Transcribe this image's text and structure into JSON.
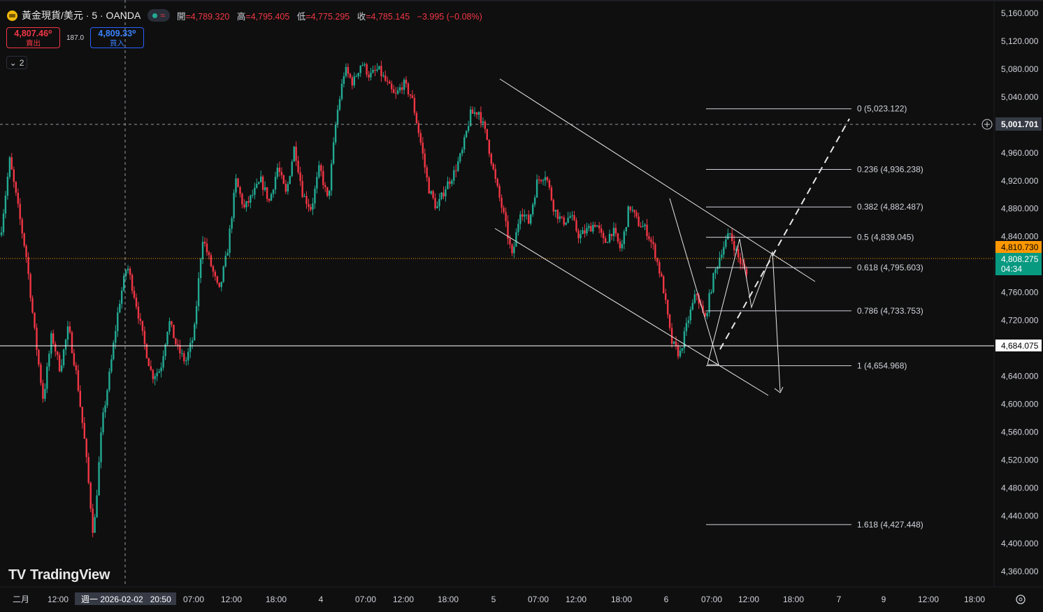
{
  "header": {
    "symbol": "黃金現貨/美元 · 5 · OANDA",
    "open_label": "開",
    "open": "=4,789.320",
    "high_label": "高",
    "high": "=4,795.405",
    "low_label": "低",
    "low": "=4,775.295",
    "close_label": "收",
    "close": "=4,785.145",
    "change": "−3.995 (−0.08%)"
  },
  "trade": {
    "sell_price": "4,807.46⁰",
    "sell_label": "賣出",
    "spread": "187.0",
    "buy_price": "4,809.33⁰",
    "buy_label": "買入",
    "collapse_count": "2"
  },
  "logo_text": "TradingView",
  "colors": {
    "up": "#22ab94",
    "down": "#f23645",
    "background": "#0f0f0f",
    "current_price": "#ff9800",
    "countdown": "#22ab94"
  },
  "price_axis": {
    "ticks": [
      "5,160.000",
      "5,120.000",
      "5,080.000",
      "5,040.000",
      "4,960.000",
      "4,920.000",
      "4,880.000",
      "4,840.000",
      "4,760.000",
      "4,720.000",
      "4,640.000",
      "4,600.000",
      "4,560.000",
      "4,520.000",
      "4,480.000",
      "4,440.000",
      "4,400.000",
      "4,360.000"
    ],
    "crosshair_price": "5,001.701",
    "current_price": "4,810.730",
    "last_price": "4,808.275",
    "countdown": "04:34",
    "hline_price": "4,684.075"
  },
  "time_axis": {
    "labels": [
      "二月",
      "12:00",
      "07:00",
      "12:00",
      "18:00",
      "4",
      "07:00",
      "12:00",
      "18:00",
      "5",
      "07:00",
      "12:00",
      "18:00",
      "6",
      "07:00",
      "12:00",
      "18:00",
      "7",
      "9",
      "12:00",
      "18:00"
    ],
    "crosshair_label": "週一 2026-02-02   20:50"
  },
  "fibonacci": [
    {
      "level": "0",
      "price": "(5,023.122)"
    },
    {
      "level": "0.236",
      "price": "(4,936.238)"
    },
    {
      "level": "0.382",
      "price": "(4,882.487)"
    },
    {
      "level": "0.5",
      "price": "(4,839.045)"
    },
    {
      "level": "0.618",
      "price": "(4,795.603)"
    },
    {
      "level": "0.786",
      "price": "(4,733.753)"
    },
    {
      "level": "1",
      "price": "(4,654.968)"
    },
    {
      "level": "1.618",
      "price": "(4,427.448)"
    }
  ],
  "chart_data": {
    "type": "candlestick",
    "title": "黃金現貨/美元 · 5 · OANDA",
    "ylim": [
      4340,
      5180
    ],
    "path": [
      [
        4853,
        4842
      ],
      [
        4950,
        4852
      ],
      [
        4880,
        4935
      ],
      [
        4810,
        4880
      ],
      [
        4700,
        4810
      ],
      [
        4606,
        4700
      ],
      [
        4700,
        4606
      ],
      [
        4650,
        4700
      ],
      [
        4710,
        4650
      ],
      [
        4640,
        4710
      ],
      [
        4540,
        4640
      ],
      [
        4410,
        4540
      ],
      [
        4570,
        4410
      ],
      [
        4650,
        4570
      ],
      [
        4740,
        4650
      ],
      [
        4800,
        4740
      ],
      [
        4750,
        4800
      ],
      [
        4690,
        4750
      ],
      [
        4640,
        4690
      ],
      [
        4650,
        4640
      ],
      [
        4720,
        4650
      ],
      [
        4680,
        4720
      ],
      [
        4660,
        4680
      ],
      [
        4700,
        4660
      ],
      [
        4840,
        4700
      ],
      [
        4800,
        4840
      ],
      [
        4760,
        4800
      ],
      [
        4820,
        4760
      ],
      [
        4920,
        4820
      ],
      [
        4880,
        4920
      ],
      [
        4900,
        4880
      ],
      [
        4920,
        4900
      ],
      [
        4890,
        4920
      ],
      [
        4940,
        4890
      ],
      [
        4900,
        4940
      ],
      [
        4970,
        4900
      ],
      [
        4900,
        4970
      ],
      [
        4880,
        4900
      ],
      [
        4940,
        4880
      ],
      [
        4890,
        4940
      ],
      [
        5010,
        4890
      ],
      [
        5080,
        5010
      ],
      [
        5060,
        5080
      ],
      [
        5090,
        5060
      ],
      [
        5070,
        5090
      ],
      [
        5080,
        5070
      ],
      [
        5060,
        5080
      ],
      [
        5040,
        5060
      ],
      [
        5060,
        5040
      ],
      [
        5040,
        5060
      ],
      [
        4980,
        5040
      ],
      [
        4910,
        4980
      ],
      [
        4880,
        4910
      ],
      [
        4910,
        4880
      ],
      [
        4930,
        4910
      ],
      [
        4960,
        4930
      ],
      [
        5015,
        4960
      ],
      [
        5020,
        5015
      ],
      [
        4980,
        5020
      ],
      [
        4920,
        4980
      ],
      [
        4870,
        4920
      ],
      [
        4810,
        4870
      ],
      [
        4880,
        4810
      ],
      [
        4860,
        4880
      ],
      [
        4920,
        4860
      ],
      [
        4930,
        4920
      ],
      [
        4880,
        4930
      ],
      [
        4860,
        4880
      ],
      [
        4870,
        4860
      ],
      [
        4840,
        4870
      ],
      [
        4850,
        4840
      ],
      [
        4860,
        4850
      ],
      [
        4830,
        4860
      ],
      [
        4850,
        4830
      ],
      [
        4820,
        4850
      ],
      [
        4885,
        4820
      ],
      [
        4860,
        4885
      ],
      [
        4850,
        4860
      ],
      [
        4820,
        4850
      ],
      [
        4770,
        4820
      ],
      [
        4690,
        4770
      ],
      [
        4670,
        4690
      ],
      [
        4720,
        4670
      ],
      [
        4760,
        4720
      ],
      [
        4720,
        4760
      ],
      [
        4780,
        4720
      ],
      [
        4820,
        4780
      ],
      [
        4845,
        4820
      ],
      [
        4810,
        4845
      ],
      [
        4785,
        4810
      ]
    ]
  }
}
